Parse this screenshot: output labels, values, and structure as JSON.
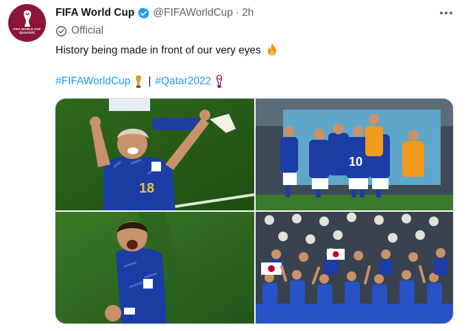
{
  "account": {
    "display_name": "FIFA World Cup",
    "handle": "@FIFAWorldCup",
    "separator": "·",
    "time": "2h",
    "label": "Official",
    "avatar_text_line1": "FIFA WORLD CUP",
    "avatar_text_line2": "Qatar2022"
  },
  "tweet": {
    "text": "History being made in front of our very eyes",
    "hashtag_1": "#FIFAWorldCup",
    "separator": "|",
    "hashtag_2": "#Qatar2022"
  },
  "photos": {
    "photo_1": {
      "jersey_number": "18"
    },
    "photo_2": {
      "jersey_number": "10"
    },
    "photo_3": {},
    "photo_4": {}
  },
  "colors": {
    "verified": "#1d9bf0",
    "hashtag": "#1d9bf0",
    "secondary_text": "#536471",
    "avatar_bg": "#8a1538"
  },
  "icons": [
    "verified-badge-icon",
    "more-options-icon",
    "official-badge-icon",
    "fire-emoji-icon",
    "trophy-emoji-icon",
    "qatar-emblem-icon"
  ]
}
